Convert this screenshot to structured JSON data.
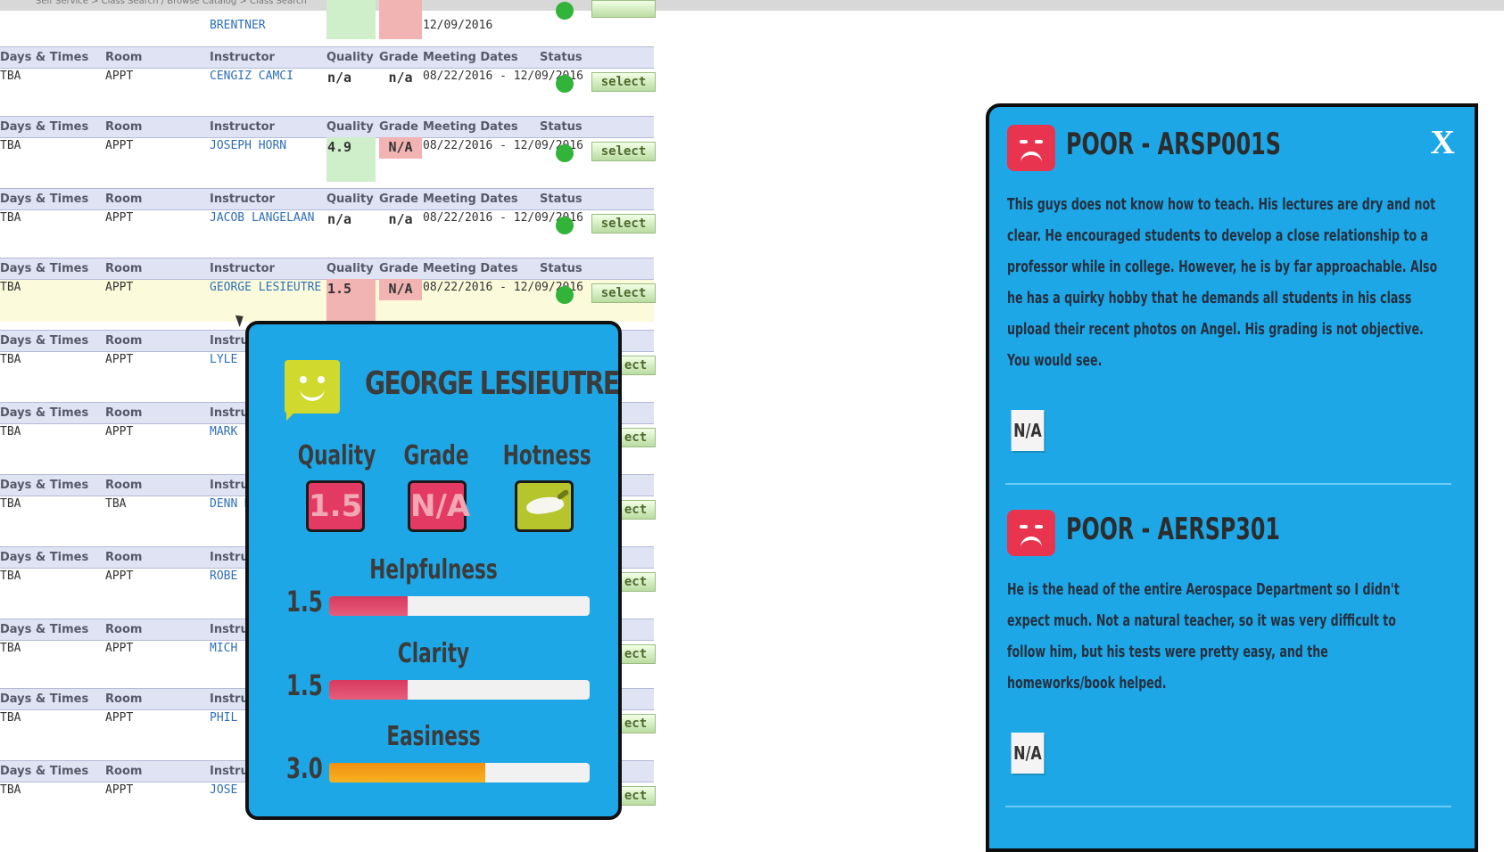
{
  "breadcrumb": "Self Service > Class Search / Browse Catalog > Class Search",
  "table": {
    "headers": {
      "days": "Days & Times",
      "room": "Room",
      "instructor": "Instructor",
      "quality": "Quality",
      "grade": "Grade",
      "dates": "Meeting Dates",
      "status": "Status"
    },
    "first_row": {
      "instructor": "BRENTNER",
      "date_end": "12/09/2016"
    },
    "rows": [
      {
        "days": "TBA",
        "room": "APPT",
        "instructor": "CENGIZ CAMCI",
        "quality": "n/a",
        "grade": "n/a",
        "dates": "08/22/2016 - 12/09/2016",
        "select": "select"
      },
      {
        "days": "TBA",
        "room": "APPT",
        "instructor": "JOSEPH HORN",
        "quality": "4.9",
        "grade": "N/A",
        "dates": "08/22/2016 - 12/09/2016",
        "select": "select"
      },
      {
        "days": "TBA",
        "room": "APPT",
        "instructor": "JACOB LANGELAAN",
        "quality": "n/a",
        "grade": "n/a",
        "dates": "08/22/2016 - 12/09/2016",
        "select": "select"
      },
      {
        "days": "TBA",
        "room": "APPT",
        "instructor": "GEORGE LESIEUTRE",
        "quality": "1.5",
        "grade": "N/A",
        "dates": "08/22/2016 - 12/09/2016",
        "select": "select"
      },
      {
        "days": "TBA",
        "room": "APPT",
        "instructor": "LYLE",
        "select": "ect"
      },
      {
        "days": "TBA",
        "room": "APPT",
        "instructor": "MARK",
        "select": "ect"
      },
      {
        "days": "TBA",
        "room": "TBA",
        "instructor": "DENN MCLA",
        "select": "ect"
      },
      {
        "days": "TBA",
        "room": "APPT",
        "instructor": "ROBE",
        "select": "ect"
      },
      {
        "days": "TBA",
        "room": "APPT",
        "instructor": "MICH",
        "select": "ect"
      },
      {
        "days": "TBA",
        "room": "APPT",
        "instructor": "PHIL",
        "select": "ect"
      },
      {
        "days": "TBA",
        "room": "APPT",
        "instructor": "JOSE",
        "select": "ect"
      }
    ]
  },
  "profile_card": {
    "name": "GEORGE LESIEUTRE",
    "quality_label": "Quality",
    "quality_value": "1.5",
    "grade_label": "Grade",
    "grade_value": "N/A",
    "hotness_label": "Hotness",
    "helpfulness_label": "Helpfulness",
    "helpfulness_value": "1.5",
    "clarity_label": "Clarity",
    "clarity_value": "1.5",
    "easiness_label": "Easiness",
    "easiness_value": "3.0",
    "helpfulness_fraction": 0.3,
    "clarity_fraction": 0.3,
    "easiness_fraction": 0.6
  },
  "reviews": {
    "close": "X",
    "items": [
      {
        "title": "POOR - ARSP001S",
        "body": "This guys does not know how to teach. His lectures are dry and not clear. He encouraged students to develop a close relationship to a professor while in college. However, he is by far approachable. Also he has a quirky hobby that he demands all students in his class upload their recent photos on Angel. His grading is not objective. You would see.",
        "tag": "N/A"
      },
      {
        "title": "POOR - AERSP301",
        "body": "He is the head of the entire Aerospace Department so I didn't expect much. Not a natural teacher, so it was very difficult to follow him, but his tests were pretty easy, and the homeworks/book helped.",
        "tag": "N/A"
      }
    ]
  },
  "colors": {
    "card_bg": "#1ea7e6",
    "poor": "#e8344f",
    "good": "#cfd92e",
    "status_open": "#32b33a"
  }
}
